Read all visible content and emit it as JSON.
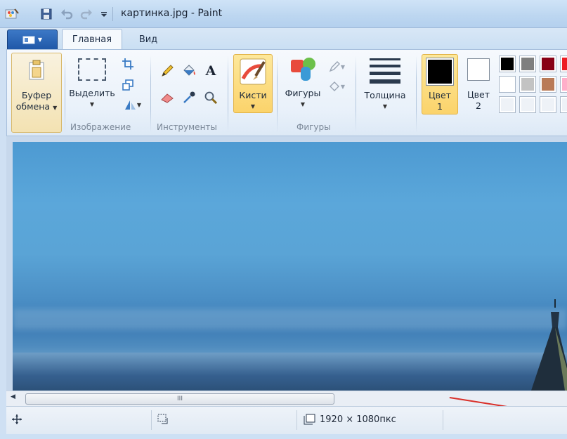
{
  "window": {
    "title": "картинка.jpg - Paint"
  },
  "menu": {
    "file_button_icon": "paint-menu-icon"
  },
  "tabs": [
    {
      "label": "Главная",
      "active": true
    },
    {
      "label": "Вид",
      "active": false
    }
  ],
  "ribbon": {
    "clipboard": {
      "line1": "Буфер",
      "line2": "обмена"
    },
    "image_group": {
      "select_label": "Выделить",
      "group_label": "Изображение"
    },
    "tools_group": {
      "group_label": "Инструменты"
    },
    "brushes": {
      "label": "Кисти"
    },
    "shapes_group": {
      "shapes_label": "Фигуры",
      "group_label": "Фигуры"
    },
    "size": {
      "label": "Толщина"
    },
    "color1": {
      "line1": "Цвет",
      "line2": "1",
      "value": "#000000"
    },
    "color2": {
      "line1": "Цвет",
      "line2": "2",
      "value": "#ffffff"
    },
    "palette_row1": [
      "#000000",
      "#7f7f7f",
      "#880015",
      "#ed1c24"
    ],
    "palette_row2": [
      "#ffffff",
      "#c3c3c3",
      "#b97a57",
      "#ffaec9"
    ],
    "palette_row3": [
      "#eef2f7",
      "#eef2f7",
      "#eef2f7",
      "#eef2f7"
    ]
  },
  "scrollbar": {
    "grip": "III"
  },
  "status": {
    "image_size": "1920 × 1080пкс"
  }
}
